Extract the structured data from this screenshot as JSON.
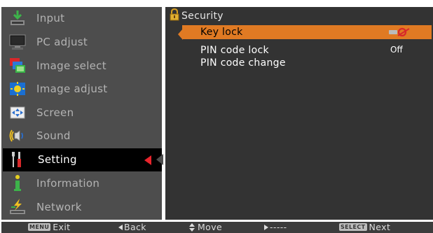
{
  "sidebar": {
    "items": [
      {
        "label": "Input",
        "icon": "input-icon"
      },
      {
        "label": "PC adjust",
        "icon": "pc-adjust-icon"
      },
      {
        "label": "Image select",
        "icon": "image-select-icon"
      },
      {
        "label": "Image adjust",
        "icon": "image-adjust-icon"
      },
      {
        "label": "Screen",
        "icon": "screen-icon"
      },
      {
        "label": "Sound",
        "icon": "sound-icon"
      },
      {
        "label": "Setting",
        "icon": "setting-icon",
        "selected": true
      },
      {
        "label": "Information",
        "icon": "information-icon"
      },
      {
        "label": "Network",
        "icon": "network-icon"
      }
    ]
  },
  "panel": {
    "title": "Security",
    "rows": [
      {
        "label": "Key lock",
        "value": "",
        "value_icon": "key-lock-status-icon",
        "selected": true
      },
      {
        "label": "PIN code lock",
        "value": "Off"
      },
      {
        "label": "PIN code change",
        "value": ""
      }
    ]
  },
  "helpbar": {
    "exit_key": "MENU",
    "exit_label": "Exit",
    "back_label": "Back",
    "move_label": "Move",
    "next_arrow_label": "-----",
    "select_key": "SELECT",
    "next_label": "Next"
  },
  "colors": {
    "sidebar_bg": "#4d4d4d",
    "panel_bg": "#333333",
    "highlight": "#e07a23",
    "marker": "#e8242c"
  }
}
